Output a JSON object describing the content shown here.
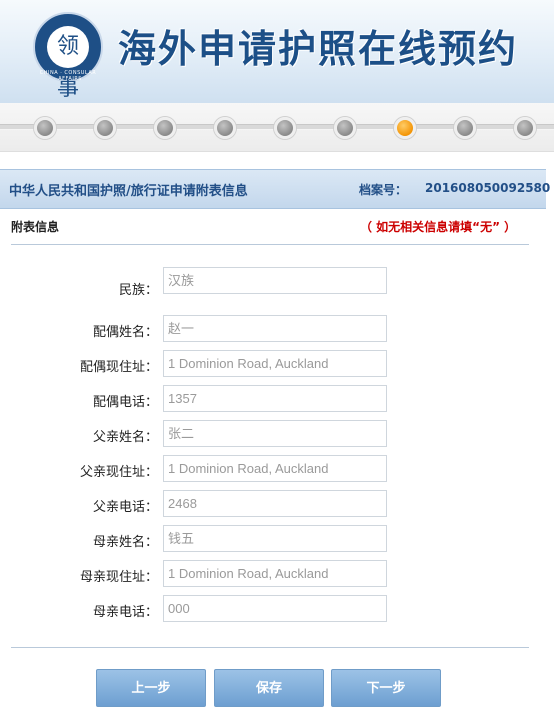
{
  "header": {
    "title": "海外申请护照在线预约",
    "logo_ring_text": "CHINA · CONSULAR · AFFAIRS",
    "logo_glyph": "领事"
  },
  "progress": {
    "total_steps": 9,
    "current_step": 7
  },
  "section": {
    "title": "中华人民共和国护照/旅行证申请附表信息",
    "file_label": "档案号：",
    "file_number": "201608050092580"
  },
  "sub": {
    "title": "附表信息",
    "hint": "（ 如无相关信息请填“无” ）"
  },
  "form": {
    "fields": [
      {
        "label": "民族：",
        "value": "汉族"
      },
      {
        "label": "配偶姓名：",
        "value": "赵一"
      },
      {
        "label": "配偶现住址：",
        "value": "1 Dominion Road, Auckland"
      },
      {
        "label": "配偶电话：",
        "value": "1357"
      },
      {
        "label": "父亲姓名：",
        "value": "张二"
      },
      {
        "label": "父亲现住址：",
        "value": "1 Dominion Road, Auckland"
      },
      {
        "label": "父亲电话：",
        "value": "2468"
      },
      {
        "label": "母亲姓名：",
        "value": "钱五"
      },
      {
        "label": "母亲现住址：",
        "value": "1 Dominion Road, Auckland"
      },
      {
        "label": "母亲电话：",
        "value": "000"
      }
    ]
  },
  "buttons": {
    "prev": "上一步",
    "save": "保存",
    "next": "下一步"
  },
  "colors": {
    "brand_blue": "#1c4f87",
    "accent_orange": "#f29100",
    "hint_red": "#cc0000"
  }
}
